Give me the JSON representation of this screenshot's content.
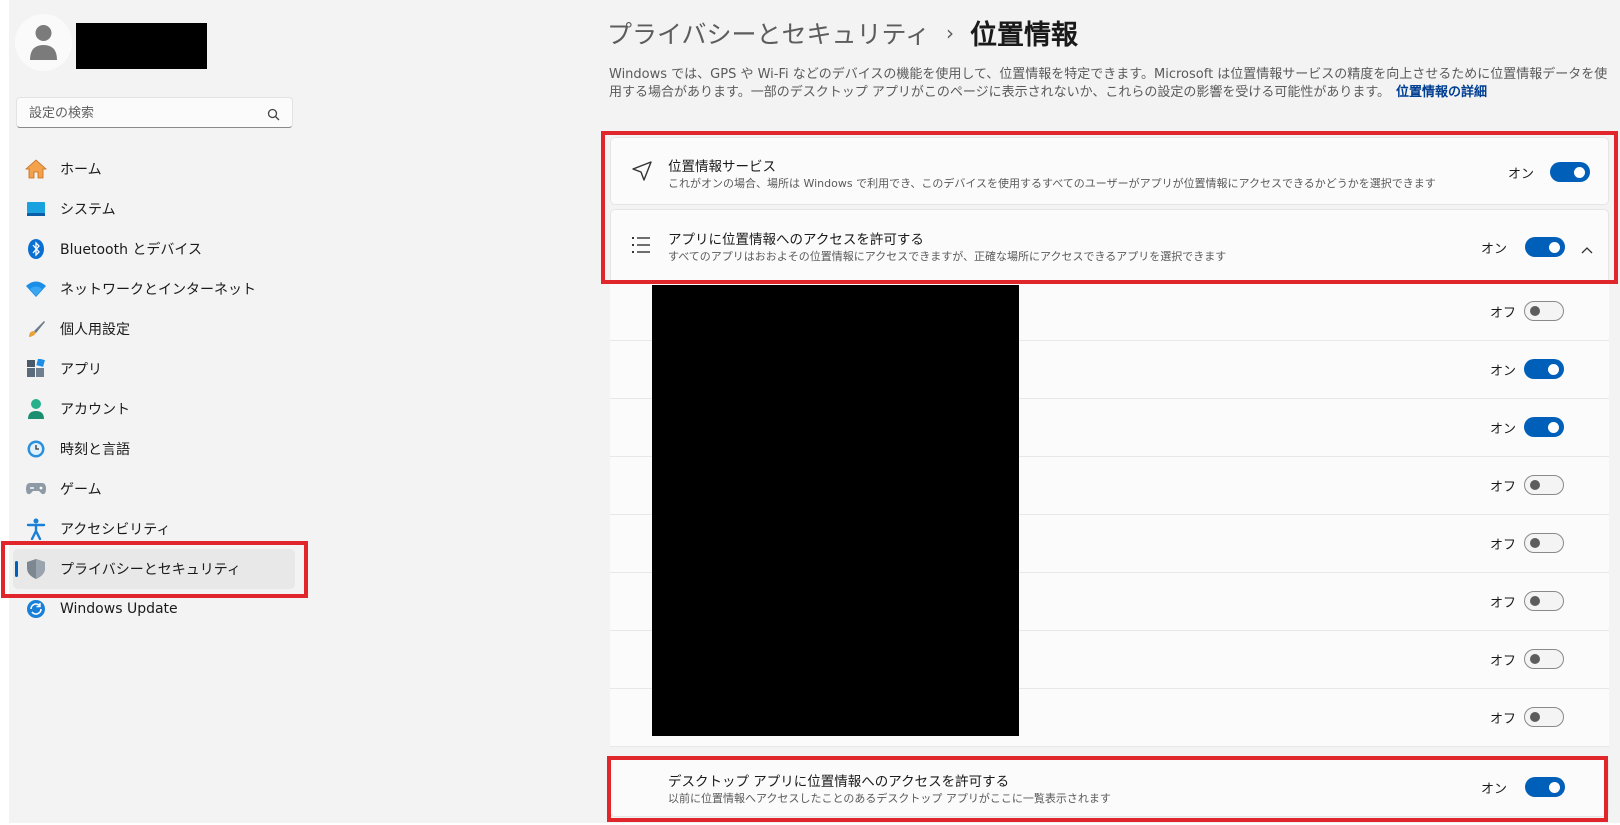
{
  "sidebar": {
    "search_placeholder": "設定の検索",
    "items": [
      {
        "label": "ホーム",
        "icon": "home-icon"
      },
      {
        "label": "システム",
        "icon": "system-icon"
      },
      {
        "label": "Bluetooth とデバイス",
        "icon": "bluetooth-icon"
      },
      {
        "label": "ネットワークとインターネット",
        "icon": "wifi-icon"
      },
      {
        "label": "個人用設定",
        "icon": "paintbrush-icon"
      },
      {
        "label": "アプリ",
        "icon": "apps-icon"
      },
      {
        "label": "アカウント",
        "icon": "account-icon"
      },
      {
        "label": "時刻と言語",
        "icon": "time-language-icon"
      },
      {
        "label": "ゲーム",
        "icon": "gamepad-icon"
      },
      {
        "label": "アクセシビリティ",
        "icon": "accessibility-icon"
      },
      {
        "label": "プライバシーとセキュリティ",
        "icon": "shield-icon",
        "selected": true
      },
      {
        "label": "Windows Update",
        "icon": "windows-update-icon"
      }
    ]
  },
  "header": {
    "parent": "プライバシーとセキュリティ",
    "separator": "›",
    "current": "位置情報"
  },
  "description": {
    "text": "Windows では、GPS や Wi-Fi などのデバイスの機能を使用して、位置情報を特定できます。Microsoft は位置情報サービスの精度を向上させるために位置情報データを使用する場合があります。一部のデスクトップ アプリがこのページに表示されないか、これらの設定の影響を受ける可能性があります。",
    "link": "位置情報の詳細"
  },
  "location_services": {
    "title": "位置情報サービス",
    "subtitle": "これがオンの場合、場所は Windows で利用でき、このデバイスを使用するすべてのユーザーがアプリが位置情報にアクセスできるかどうかを選択できます",
    "state": "オン",
    "on": true
  },
  "app_access": {
    "title": "アプリに位置情報へのアクセスを許可する",
    "subtitle": "すべてのアプリはおおよその位置情報にアクセスできますが、正確な場所にアクセスできるアプリを選択できます",
    "state": "オン",
    "on": true
  },
  "apps": [
    {
      "state": "オフ",
      "on": false
    },
    {
      "state": "オン",
      "on": true
    },
    {
      "state": "オン",
      "on": true
    },
    {
      "state": "オフ",
      "on": false
    },
    {
      "state": "オフ",
      "on": false
    },
    {
      "state": "オフ",
      "on": false
    },
    {
      "state": "オフ",
      "on": false
    },
    {
      "state": "オフ",
      "on": false
    }
  ],
  "desktop_access": {
    "title": "デスクトップ アプリに位置情報へのアクセスを許可する",
    "subtitle": "以前に位置情報へアクセスしたことのあるデスクトップ アプリがここに一覧表示されます",
    "state": "オン",
    "on": true
  },
  "colors": {
    "accent": "#005fb8",
    "highlight": "#e0262a",
    "background": "#f3f3f3"
  }
}
